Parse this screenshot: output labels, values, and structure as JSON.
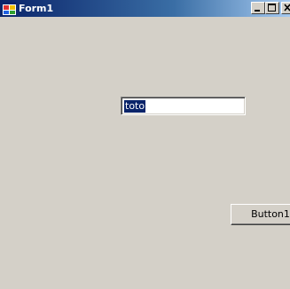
{
  "window": {
    "title": "Form1",
    "icon": "form-app-icon",
    "controls": {
      "minimize_icon": "minimize-icon",
      "maximize_icon": "maximize-icon",
      "close_icon": "close-icon"
    }
  },
  "form": {
    "textbox": {
      "value": "toto",
      "selected": true
    },
    "button": {
      "label": "Button1"
    }
  },
  "colors": {
    "title_start": "#0a246a",
    "title_end": "#a6caf0",
    "face": "#d4d0c8",
    "selection": "#0a246a"
  }
}
